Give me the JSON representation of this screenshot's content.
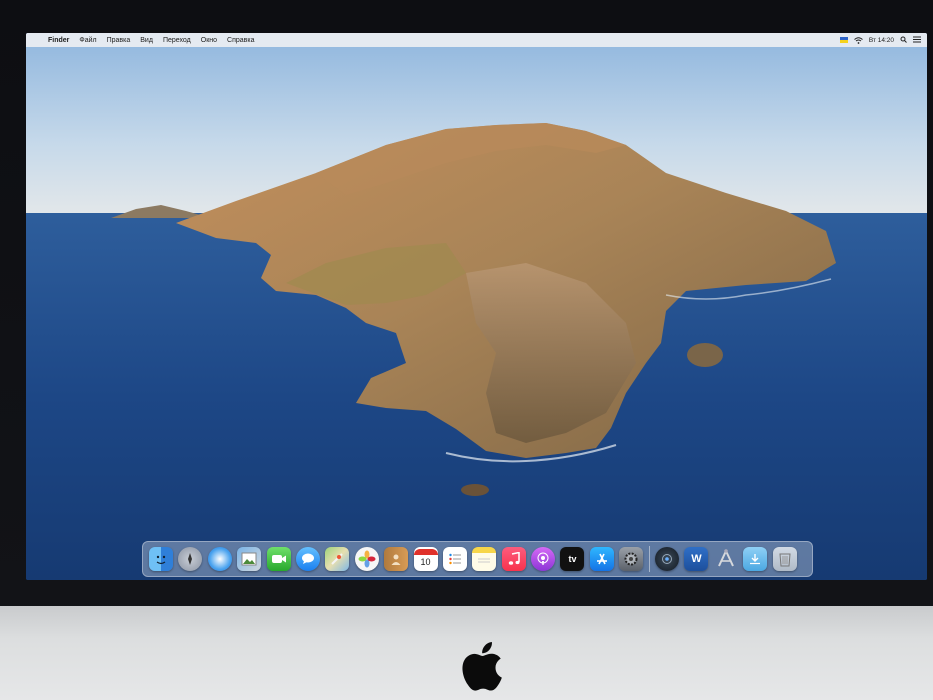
{
  "menubar": {
    "apple_symbol": "",
    "items": [
      "Finder",
      "Файл",
      "Правка",
      "Вид",
      "Переход",
      "Окно",
      "Справка"
    ],
    "clock": "Вт 14:20"
  },
  "dock": {
    "icons": [
      {
        "name": "finder-icon"
      },
      {
        "name": "launchpad-icon"
      },
      {
        "name": "safari-icon"
      },
      {
        "name": "photo-viewer-icon"
      },
      {
        "name": "facetime-icon"
      },
      {
        "name": "messages-icon"
      },
      {
        "name": "maps-icon"
      },
      {
        "name": "photos-icon"
      },
      {
        "name": "contacts-icon"
      },
      {
        "name": "calendar-icon",
        "text": "10"
      },
      {
        "name": "reminders-icon"
      },
      {
        "name": "notes-icon"
      },
      {
        "name": "music-icon"
      },
      {
        "name": "podcasts-icon"
      },
      {
        "name": "apple-tv-icon",
        "text": "tv"
      },
      {
        "name": "app-store-icon"
      },
      {
        "name": "system-preferences-icon"
      },
      {
        "name": "screenshot-app-icon"
      },
      {
        "name": "word-icon",
        "text": "W"
      },
      {
        "name": "xcode-tool-icon"
      },
      {
        "name": "downloads-folder-icon"
      },
      {
        "name": "trash-icon"
      }
    ]
  },
  "colors": {
    "sea": "#1e4a8c",
    "sky": "#c9dcee",
    "island": "#9a7a4e",
    "bezel": "#0d0e12",
    "chin": "#d9dbdc"
  }
}
